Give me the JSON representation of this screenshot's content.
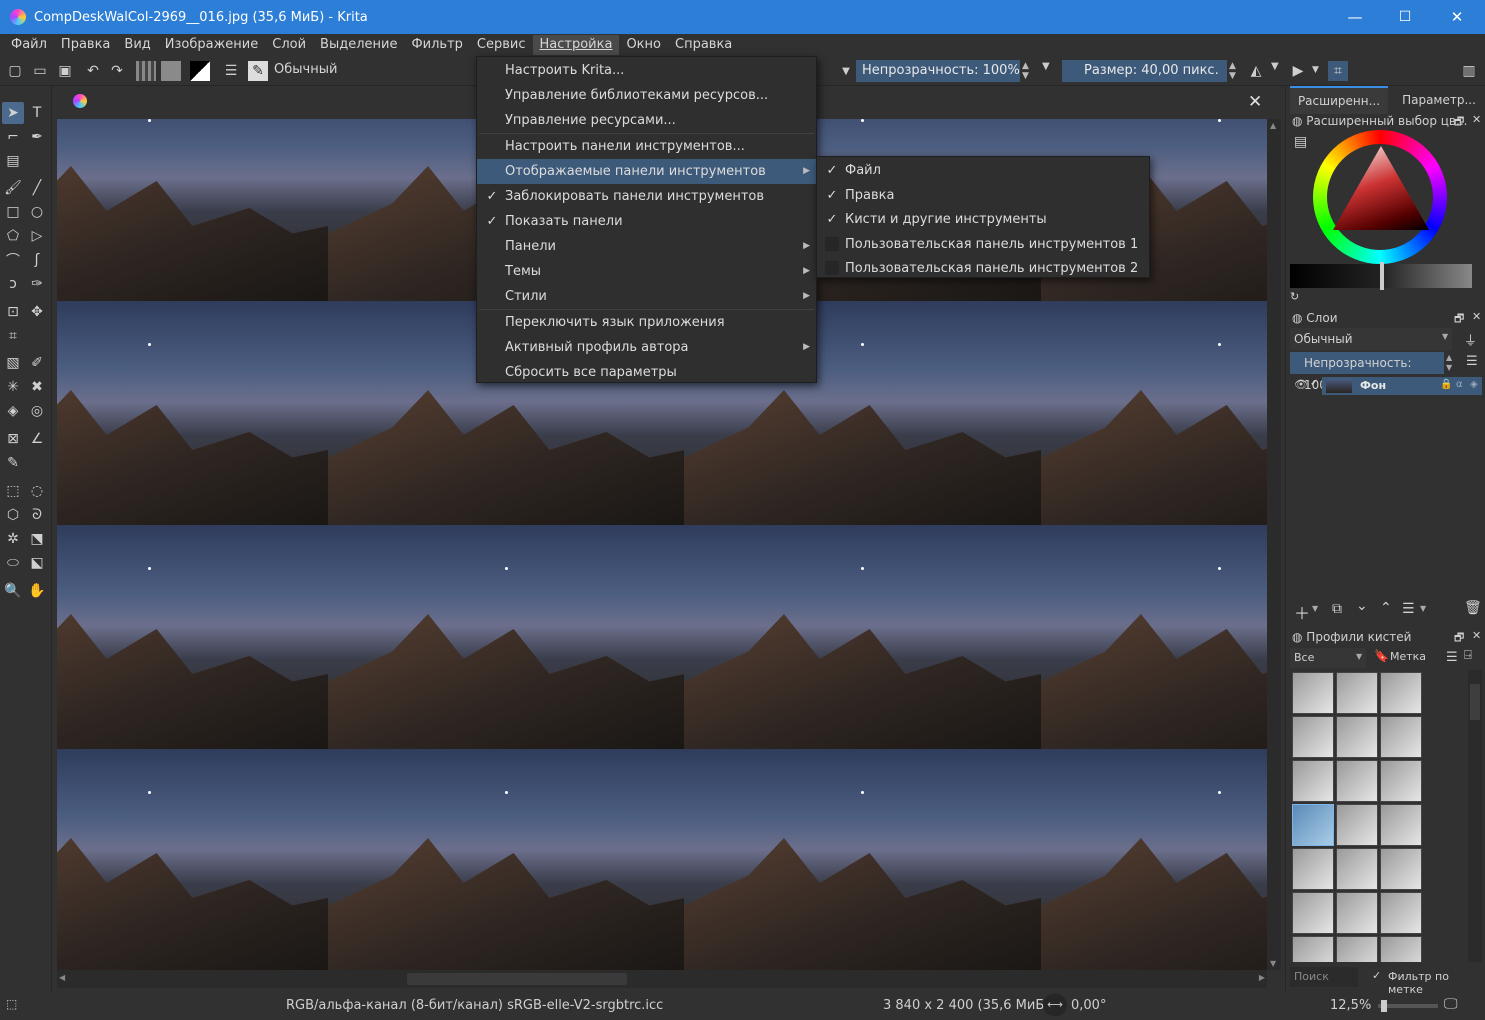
{
  "window": {
    "title": "CompDeskWalCol-2969__016.jpg (35,6 МиБ)  - Krita",
    "minimize": "—",
    "maximize": "☐",
    "close": "✕"
  },
  "menubar": [
    "Файл",
    "Правка",
    "Вид",
    "Изображение",
    "Слой",
    "Выделение",
    "Фильтр",
    "Сервис",
    "Настройка",
    "Окно",
    "Справка"
  ],
  "toolbar": {
    "blend_mode": "Обычный",
    "opacity": "Непрозрачность: 100%",
    "size": "Размер: 40,00 пикс."
  },
  "settings_menu": [
    {
      "label": "Настроить Krita...",
      "check": "",
      "submenu": false
    },
    {
      "label": "Управление библиотеками ресурсов...",
      "check": "",
      "submenu": false
    },
    {
      "label": "Управление ресурсами...",
      "check": "",
      "submenu": false
    },
    {
      "label": "Настроить панели инструментов...",
      "check": "",
      "submenu": false
    },
    {
      "label": "Отображаемые панели инструментов",
      "check": "",
      "submenu": true,
      "highlight": true
    },
    {
      "label": "Заблокировать панели инструментов",
      "check": "✓",
      "submenu": false
    },
    {
      "label": "Показать панели",
      "check": "✓",
      "submenu": false
    },
    {
      "label": "Панели",
      "check": "",
      "submenu": true
    },
    {
      "label": "Темы",
      "check": "",
      "submenu": true
    },
    {
      "label": "Стили",
      "check": "",
      "submenu": true
    },
    {
      "label": "Переключить язык приложения",
      "check": "",
      "submenu": false
    },
    {
      "label": "Активный профиль автора",
      "check": "",
      "submenu": true
    },
    {
      "label": "Сбросить все параметры",
      "check": "",
      "submenu": false
    }
  ],
  "toolbars_submenu": [
    {
      "label": "Файл",
      "check": "✓"
    },
    {
      "label": "Правка",
      "check": "✓"
    },
    {
      "label": "Кисти и другие инструменты",
      "check": "✓"
    },
    {
      "label": "Пользовательская панель инструментов 1",
      "check": ""
    },
    {
      "label": "Пользовательская панель инструментов 2",
      "check": ""
    }
  ],
  "right_panel": {
    "tabs": [
      "Расширенн...",
      "Параметр..."
    ],
    "color_selector_title": "Расширенный выбор цв...",
    "layers_title": "Слои",
    "layer_blend": "Обычный",
    "layer_opacity": "Непрозрачность: 100%",
    "layer_name": "Фон",
    "brushes_title": "Профили кистей",
    "brush_filter": "Все",
    "brush_tag": "Метка",
    "search_placeholder": "Поиск",
    "filter_by_tag": "Фильтр по метке"
  },
  "status": {
    "colorspace": "RGB/альфа-канал (8-бит/канал)  sRGB-elle-V2-srgbtrc.icc",
    "dimensions": "3 840 x 2 400 (35,6 МиБ)",
    "rotation": "0,00°",
    "zoom": "12,5%"
  },
  "colors": {
    "accent": "#3d5a7a",
    "titlebar": "#2c7ed6"
  }
}
